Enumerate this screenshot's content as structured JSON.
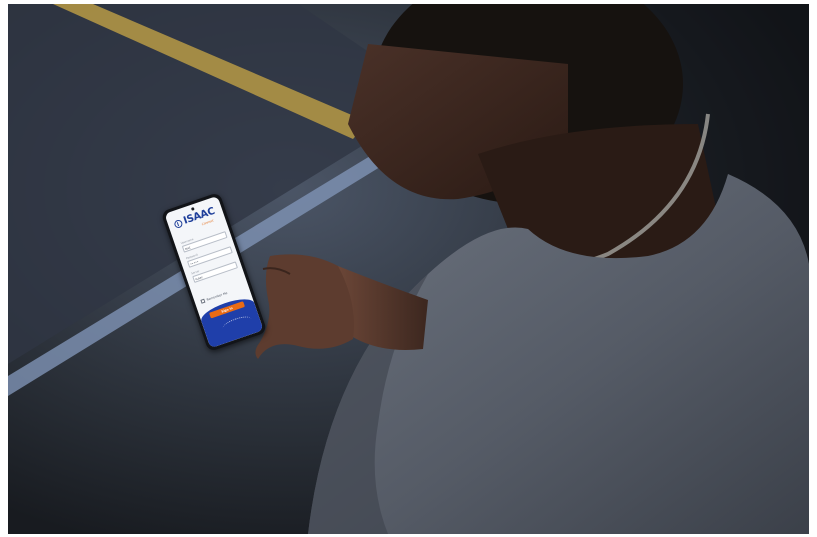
{
  "app": {
    "logo_text": "ISAAC",
    "logo_sub": "Connect",
    "brand_color": "#1f3f9a",
    "accent_color": "#e96b14"
  },
  "login": {
    "username_label": "Username",
    "username_value": "test",
    "password_label": "Password",
    "password_value": "•••••",
    "server_label": "Server",
    "server_value": "isaac",
    "remember_label": "Remember Me",
    "signin_label": "Sign In"
  }
}
